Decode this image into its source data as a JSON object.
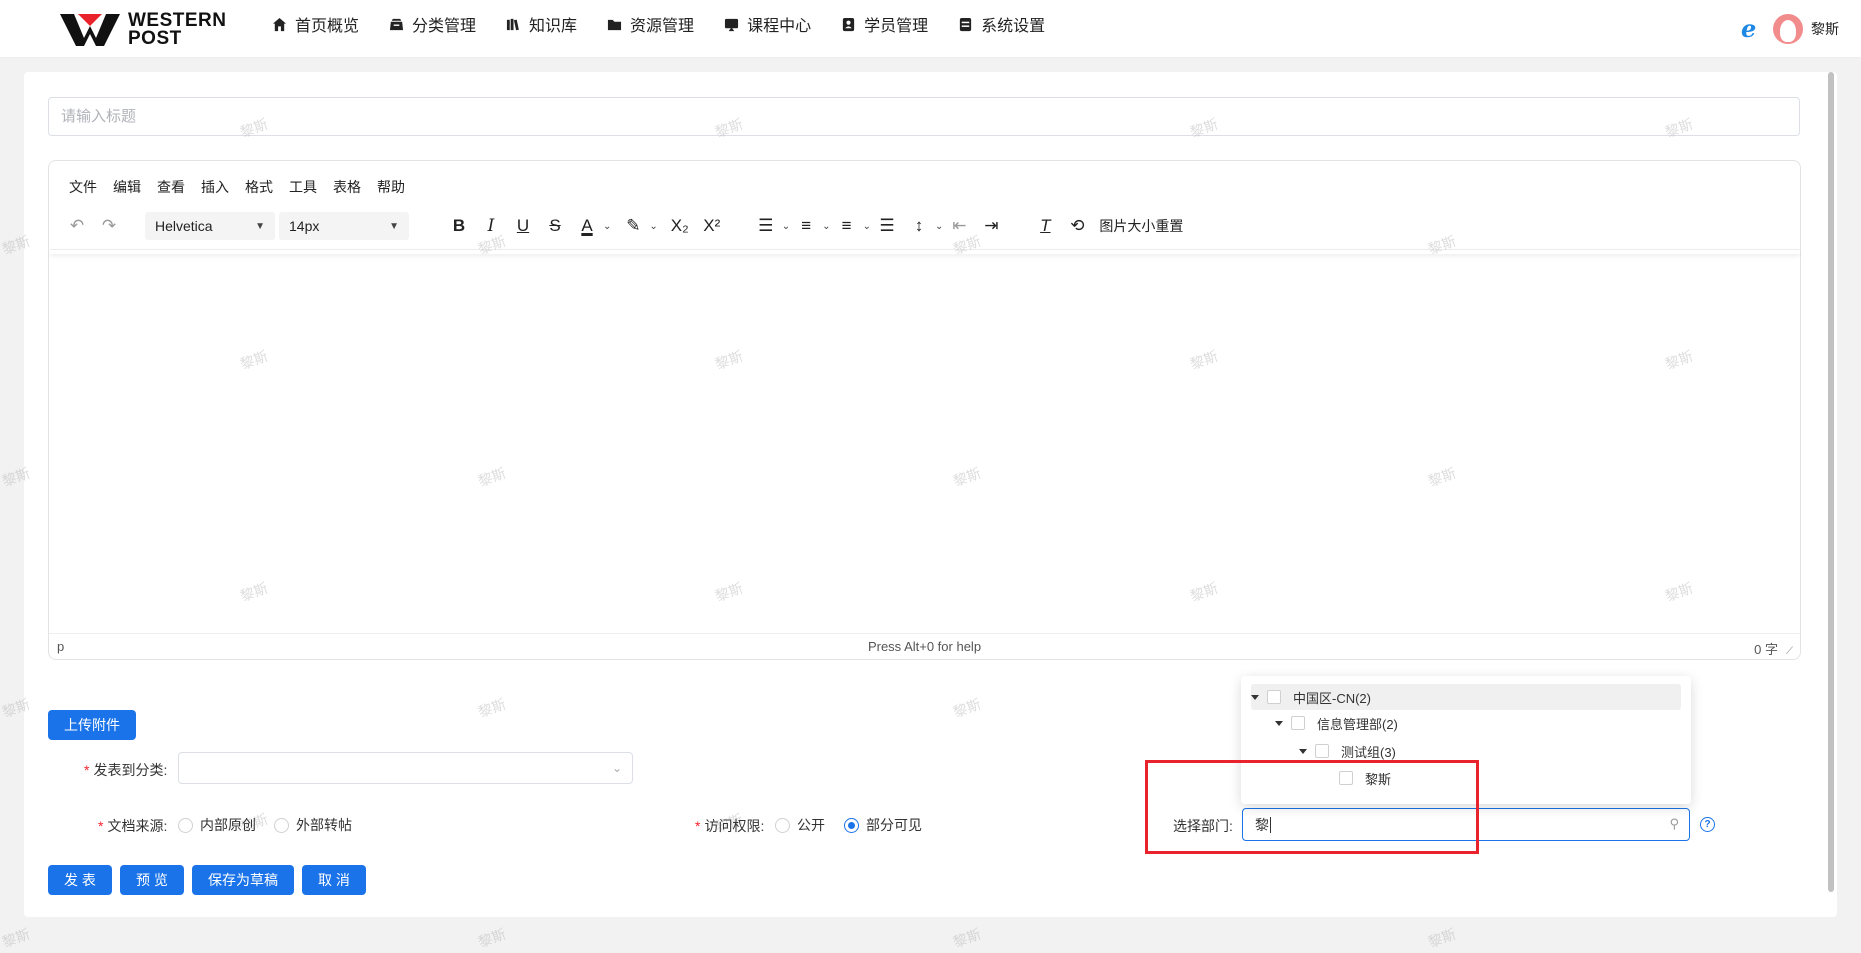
{
  "header": {
    "logo_line1": "WESTERN",
    "logo_line2": "POST",
    "nav": [
      {
        "label": "首页概览",
        "icon": "home-icon"
      },
      {
        "label": "分类管理",
        "icon": "category-icon"
      },
      {
        "label": "知识库",
        "icon": "book-icon"
      },
      {
        "label": "资源管理",
        "icon": "folder-icon"
      },
      {
        "label": "课程中心",
        "icon": "course-icon"
      },
      {
        "label": "学员管理",
        "icon": "user-badge-icon"
      },
      {
        "label": "系统设置",
        "icon": "settings-icon"
      }
    ],
    "ie_glyph": "e",
    "user_name": "黎斯"
  },
  "editor": {
    "title_placeholder": "请输入标题",
    "menu": [
      "文件",
      "编辑",
      "查看",
      "插入",
      "格式",
      "工具",
      "表格",
      "帮助"
    ],
    "font_family": "Helvetica",
    "font_size": "14px",
    "image_reset_label": "图片大小重置",
    "status_path": "p",
    "status_help": "Press Alt+0 for help",
    "word_count": "0 字"
  },
  "form": {
    "upload_label": "上传附件",
    "category_label": "发表到分类:",
    "source_label": "文档来源:",
    "source_options": [
      "内部原创",
      "外部转帖"
    ],
    "access_label": "访问权限:",
    "access_options": [
      "公开",
      "部分可见"
    ],
    "access_selected": "部分可见",
    "dept_label": "选择部门:",
    "dept_value": "黎",
    "help_glyph": "?"
  },
  "tree": [
    {
      "label": "中国区-CN(2)",
      "level": 0,
      "expanded": true
    },
    {
      "label": "信息管理部(2)",
      "level": 1,
      "expanded": true
    },
    {
      "label": "测试组(3)",
      "level": 2,
      "expanded": true
    },
    {
      "label": "黎斯",
      "level": 3,
      "expanded": false
    }
  ],
  "actions": {
    "publish": "发 表",
    "preview": "预 览",
    "save_draft": "保存为草稿",
    "cancel": "取 消"
  },
  "watermark": "黎斯",
  "colors": {
    "primary": "#1a73e8",
    "highlight": "#e8232b",
    "required": "#f5222d"
  }
}
